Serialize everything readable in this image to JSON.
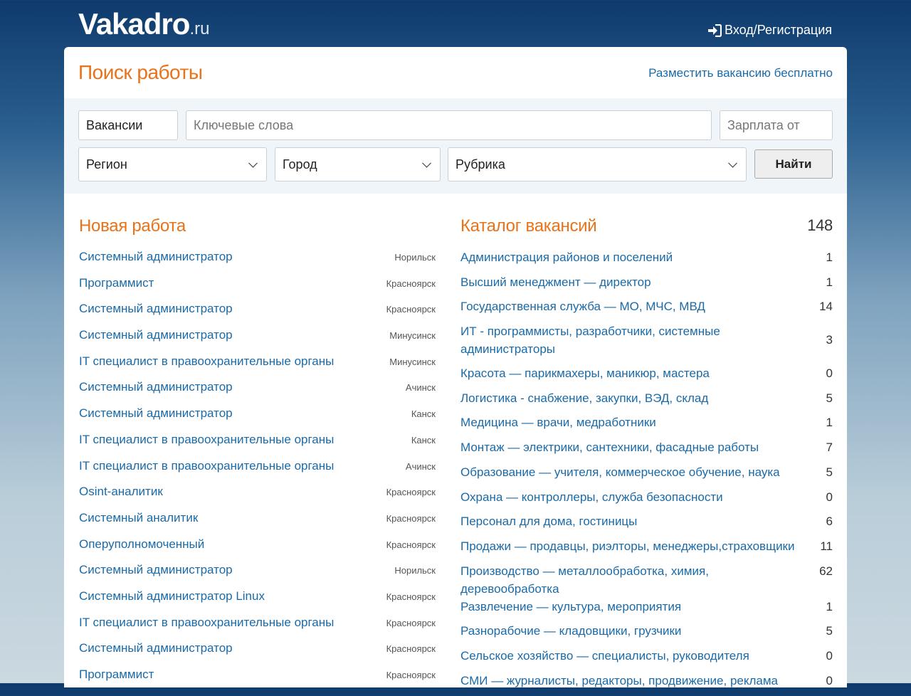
{
  "header": {
    "logo_main": "Vakadro",
    "logo_tld": ".ru",
    "login_label": "Вход/Регистрация"
  },
  "page": {
    "title": "Поиск работы",
    "post_vacancy": "Разместить вакансию бесплатно"
  },
  "search": {
    "type_value": "Вакансии",
    "keywords_placeholder": "Ключевые слова",
    "salary_placeholder": "Зарплата от",
    "region": "Регион",
    "city": "Город",
    "category": "Рубрика",
    "submit": "Найти"
  },
  "new_jobs": {
    "title": "Новая работа",
    "items": [
      {
        "title": "Системный администратор",
        "city": "Норильск"
      },
      {
        "title": "Программист",
        "city": "Красноярск"
      },
      {
        "title": "Системный администратор",
        "city": "Красноярск"
      },
      {
        "title": "Системный администратор",
        "city": "Минусинск"
      },
      {
        "title": "IT специалист в правоохранительные органы",
        "city": "Минусинск"
      },
      {
        "title": "Системный администратор",
        "city": "Ачинск"
      },
      {
        "title": "Системный администратор",
        "city": "Канск"
      },
      {
        "title": "IT специалист в правоохранительные органы",
        "city": "Канск"
      },
      {
        "title": "IT специалист в правоохранительные органы",
        "city": "Ачинск"
      },
      {
        "title": "Osint-аналитик",
        "city": "Красноярск"
      },
      {
        "title": "Системный аналитик",
        "city": "Красноярск"
      },
      {
        "title": "Оперуполномоченный",
        "city": "Красноярск"
      },
      {
        "title": "Системный администратор",
        "city": "Норильск"
      },
      {
        "title": "Системный администратор Linux",
        "city": "Красноярск"
      },
      {
        "title": "IT специалист в правоохранительные органы",
        "city": "Красноярск"
      },
      {
        "title": "Системный администратор",
        "city": "Красноярск"
      },
      {
        "title": "Программист",
        "city": "Красноярск"
      }
    ]
  },
  "catalog": {
    "title": "Каталог вакансий",
    "total": "148",
    "items": [
      {
        "title": "Администрация районов и поселений",
        "count": "1"
      },
      {
        "title": "Высший менеджмент — директор",
        "count": "1"
      },
      {
        "title": "Государственная служба — МО, МЧС, МВД",
        "count": "14"
      },
      {
        "title": "ИТ - программисты, разработчики, системные администраторы",
        "count": "3"
      },
      {
        "title": "Красота — парикмахеры, маникюр, мастера",
        "count": "0"
      },
      {
        "title": "Логистика - снабжение, закупки, ВЭД, склад",
        "count": "5"
      },
      {
        "title": "Медицина — врачи, медработники",
        "count": "1"
      },
      {
        "title": "Монтаж — электрики, сантехники, фасадные работы",
        "count": "7"
      },
      {
        "title": "Образование — учителя, коммерческое обучение, наука",
        "count": "5"
      },
      {
        "title": "Охрана — контроллеры, служба безопасности",
        "count": "0"
      },
      {
        "title": "Персонал для дома, гостиницы",
        "count": "6"
      },
      {
        "title": "Продажи — продавцы, риэлторы, менеджеры,страховщики",
        "count": "11"
      },
      {
        "title": "Производство — металлообработка, химия, деревообработка",
        "count": "62"
      },
      {
        "title": "Развлечение — культура, мероприятия",
        "count": "1"
      },
      {
        "title": "Разнорабочие — кладовщики, грузчики",
        "count": "5"
      },
      {
        "title": "Сельское хозяйство — специалисты, руководителя",
        "count": "0"
      },
      {
        "title": "СМИ — журналисты, редакторы, продвижение, реклама",
        "count": "0"
      }
    ]
  }
}
